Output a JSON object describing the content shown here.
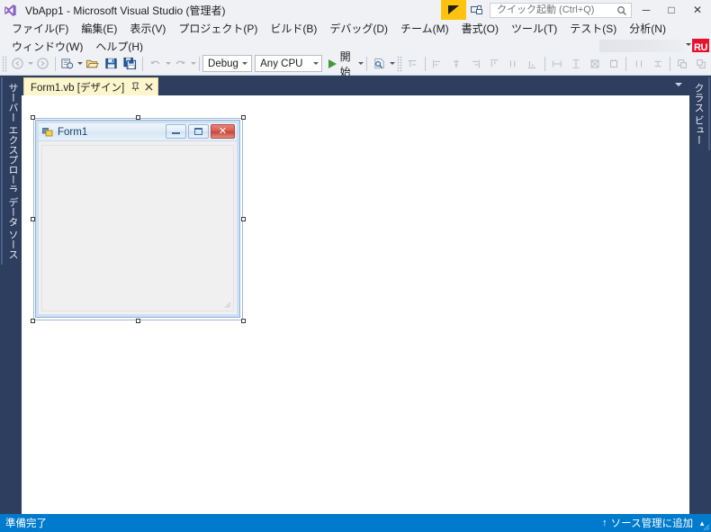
{
  "window": {
    "title": "VbApp1 - Microsoft Visual Studio  (管理者)",
    "logo_icon": "visual-studio-logo-icon",
    "minimize_label": "─",
    "maximize_label": "□",
    "close_label": "✕"
  },
  "titlebar_right": {
    "notification_icon": "notification-flag-icon",
    "feedback_icon": "send-feedback-icon",
    "quick_launch": {
      "value": "",
      "placeholder": "クイック起動 (Ctrl+Q)",
      "search_icon": "magnifier-icon"
    }
  },
  "account": {
    "name": "",
    "avatar_initials": "RU",
    "avatar_color": "#e8112d",
    "chevron_icon": "chevron-down-icon"
  },
  "menu": {
    "row1": [
      "ファイル(F)",
      "編集(E)",
      "表示(V)",
      "プロジェクト(P)",
      "ビルド(B)",
      "デバッグ(D)",
      "チーム(M)",
      "書式(O)",
      "ツール(T)",
      "テスト(S)",
      "分析(N)"
    ],
    "row2": [
      "ウィンドウ(W)",
      "ヘルプ(H)"
    ]
  },
  "toolbar": {
    "nav_back_icon": "navigate-back-icon",
    "nav_forward_icon": "navigate-forward-icon",
    "new_project_icon": "new-project-icon",
    "open_file_icon": "open-file-icon",
    "save_icon": "save-icon",
    "save_all_icon": "save-all-icon",
    "undo_icon": "undo-icon",
    "redo_icon": "redo-icon",
    "config_combo": {
      "value": "Debug",
      "chevron_icon": "chevron-down-icon"
    },
    "platform_combo": {
      "value": "Any CPU",
      "chevron_icon": "chevron-down-icon"
    },
    "start_button": {
      "label": "開始",
      "play_icon": "play-triangle-icon",
      "chevron_icon": "chevron-down-icon"
    },
    "find_icon": "find-in-files-icon",
    "overflow_icon": "toolbar-overflow-icon",
    "layout_icons": [
      "align-to-grid-icon",
      "align-lefts-icon",
      "align-centers-icon",
      "align-rights-icon",
      "align-tops-icon",
      "align-middles-icon",
      "align-bottoms-icon",
      "make-same-width-icon",
      "make-same-height-icon",
      "make-same-size-icon",
      "size-to-grid-icon",
      "horizontal-spacing-icon",
      "vertical-spacing-icon",
      "bring-to-front-icon",
      "send-to-back-icon"
    ]
  },
  "docks": {
    "left": [
      "サーバー エクスプローラー",
      "データ ソース"
    ],
    "right": [
      "クラス ビュー"
    ]
  },
  "tabs": {
    "active": {
      "label": "Form1.vb [デザイン]",
      "pin_icon": "pin-icon",
      "close_icon": "close-icon"
    },
    "overflow_icon": "chevron-down-icon"
  },
  "designer": {
    "form": {
      "caption": "Form1",
      "icon": "windows-form-icon",
      "minimize_icon": "minimize-icon",
      "maximize_icon": "maximize-icon",
      "close_icon": "close-icon",
      "close_label": "✕",
      "selected": true,
      "handle_count": 8
    },
    "background_color": "#ffffff"
  },
  "statusbar": {
    "message": "準備完了",
    "source_control": {
      "arrow_icon": "up-arrow-icon",
      "label": "ソース管理に追加",
      "chevron_icon": "chevron-up-icon",
      "arrow_glyph": "↑",
      "chevron_glyph": "▲"
    },
    "background_color": "#007acc"
  }
}
